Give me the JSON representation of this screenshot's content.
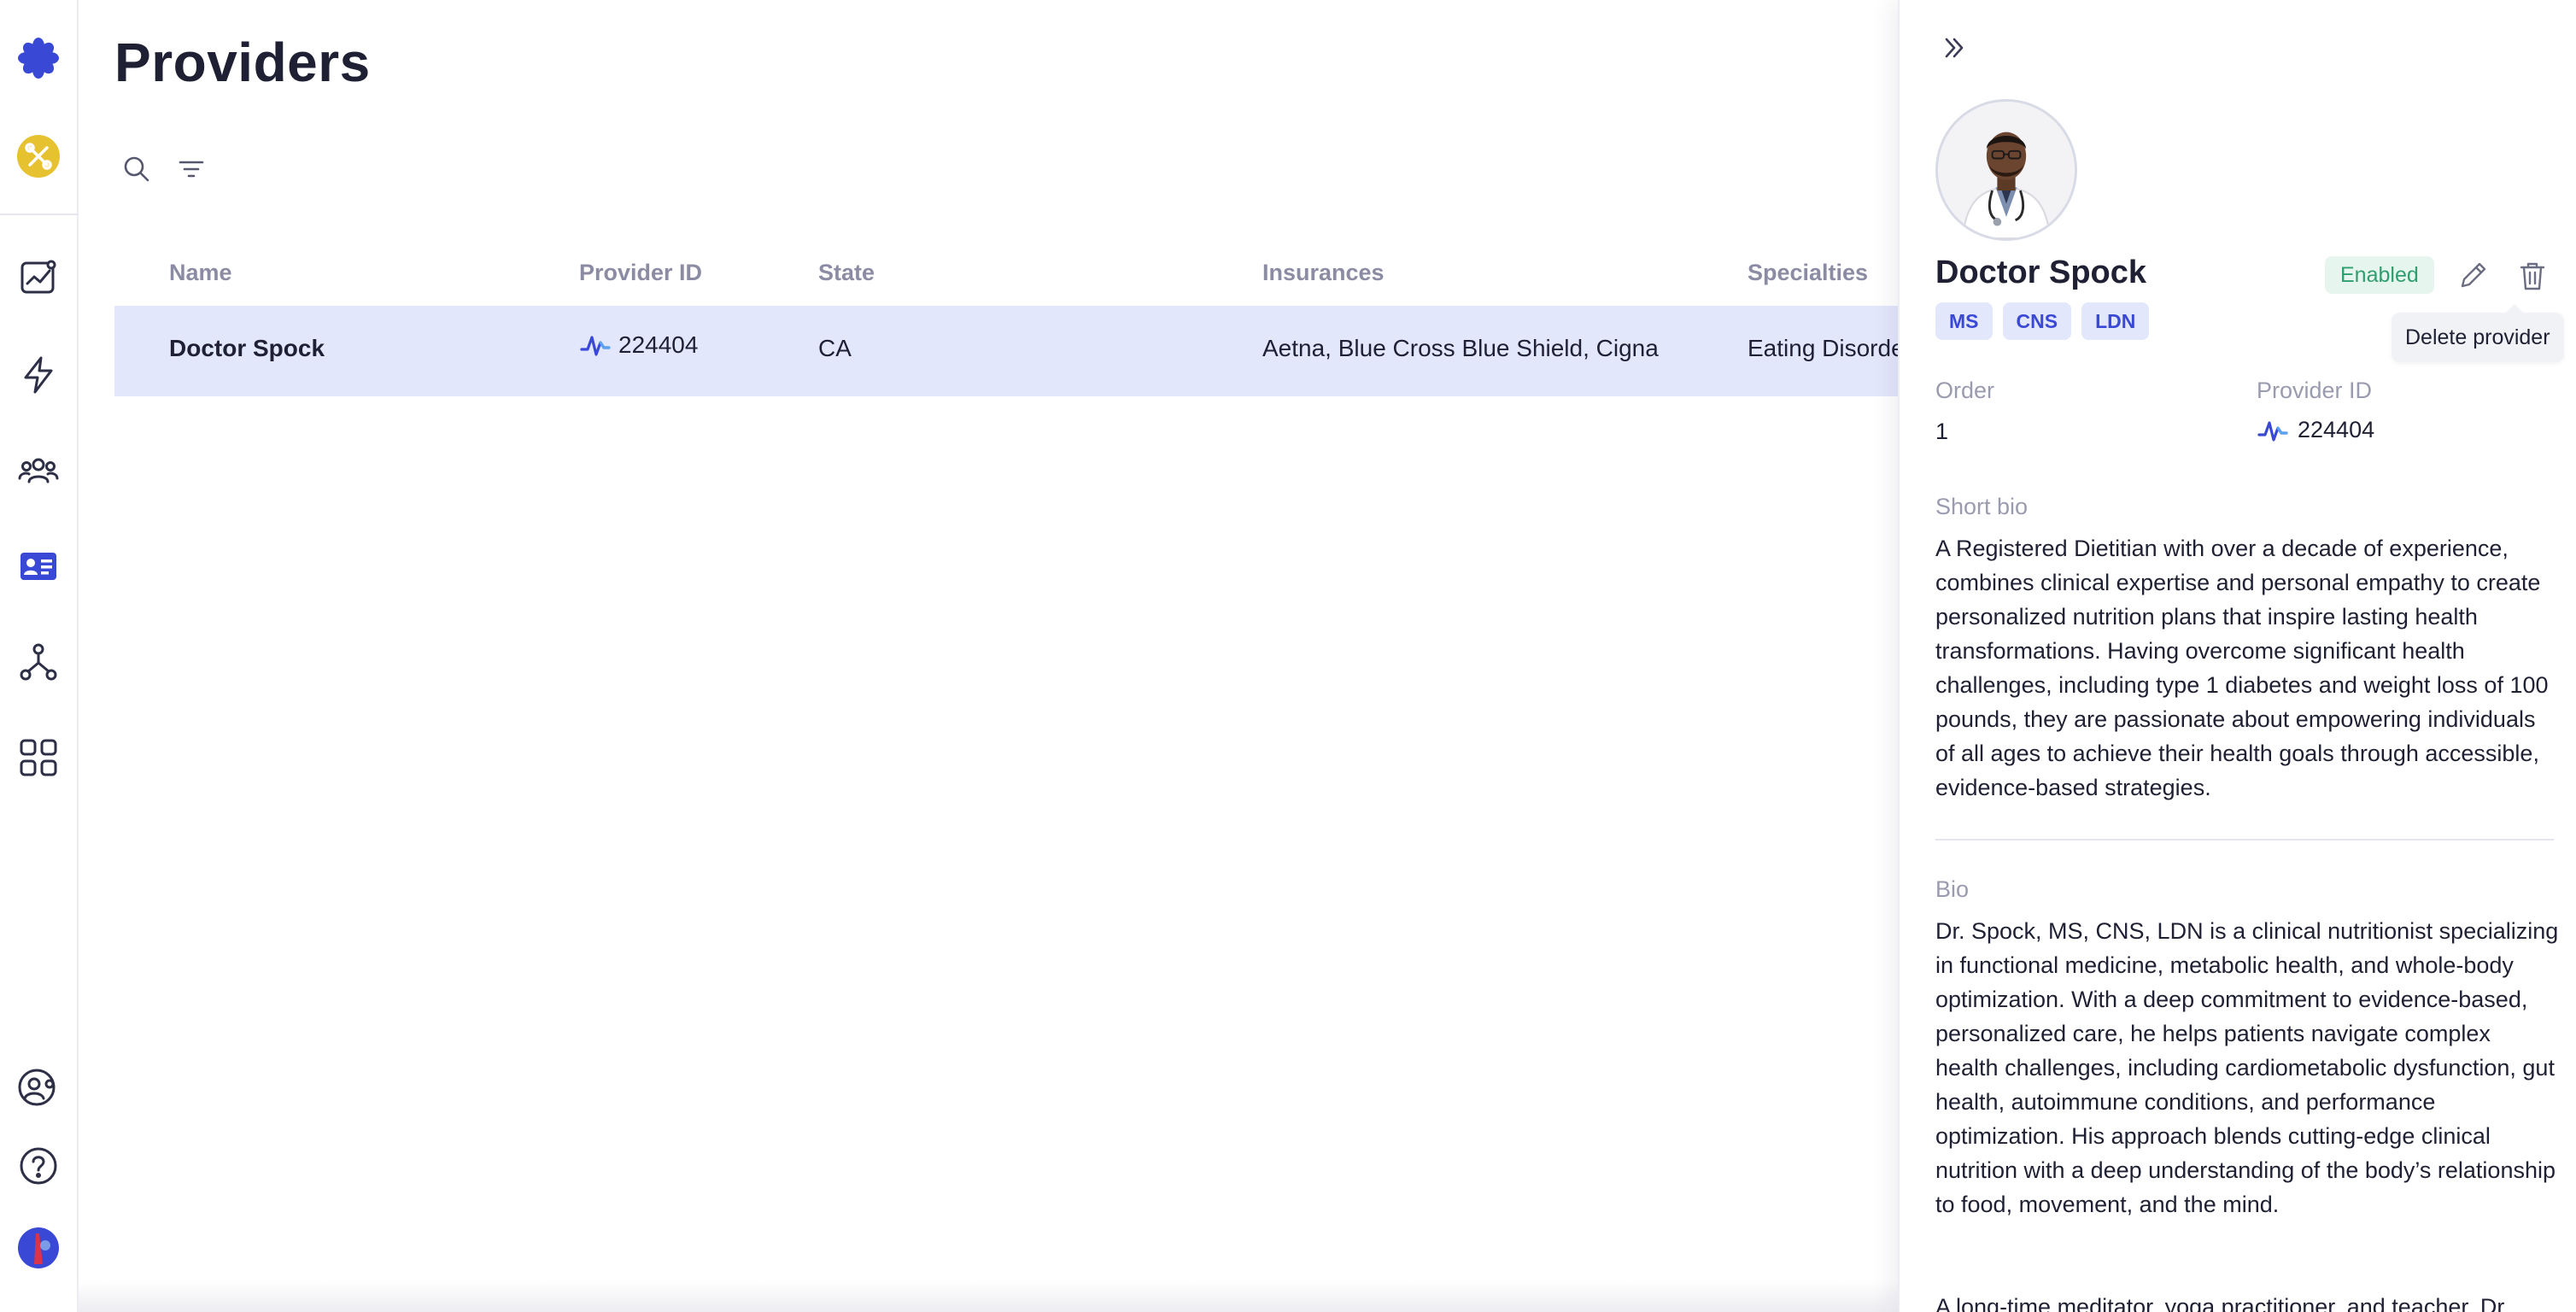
{
  "colors": {
    "accent": "#3a48d6",
    "selected_row": "#e3e7fb",
    "status_enabled": "#2f9e6f"
  },
  "nav": {
    "items": [
      {
        "name": "logo-icon"
      },
      {
        "name": "workspace-icon"
      },
      {
        "name": "analytics-icon"
      },
      {
        "name": "automations-icon"
      },
      {
        "name": "users-icon"
      },
      {
        "name": "providers-icon"
      },
      {
        "name": "integrations-icon"
      },
      {
        "name": "apps-icon"
      },
      {
        "name": "account-icon"
      },
      {
        "name": "help-icon"
      },
      {
        "name": "user-avatar"
      }
    ]
  },
  "page": {
    "title": "Providers"
  },
  "table": {
    "columns": [
      "Name",
      "Provider ID",
      "State",
      "Insurances",
      "Specialties"
    ],
    "rows": [
      {
        "name": "Doctor Spock",
        "provider_id": "224404",
        "state": "CA",
        "insurances": "Aetna, Blue Cross Blue Shield, Cigna",
        "specialties": "Eating Disorde"
      }
    ]
  },
  "panel": {
    "provider_name": "Doctor Spock",
    "status": "Enabled",
    "credentials": [
      "MS",
      "CNS",
      "LDN"
    ],
    "tooltip": "Delete provider",
    "order_label": "Order",
    "order_value": "1",
    "provider_id_label": "Provider ID",
    "provider_id_value": "224404",
    "short_bio_label": "Short bio",
    "short_bio": "A Registered Dietitian with over a decade of experience, combines clinical expertise and personal empathy to create personalized nutrition plans that inspire lasting health transformations. Having overcome significant health challenges, including type 1 diabetes and weight loss of 100 pounds, they are passionate about empowering individuals of all ages to achieve their health goals through accessible, evidence-based strategies.",
    "bio_label": "Bio",
    "bio_p1": "Dr. Spock, MS, CNS, LDN is a clinical nutritionist specializing in functional medicine, metabolic health, and whole-body optimization. With a deep commitment to evidence-based, personalized care, he helps patients navigate complex health challenges, including cardiometabolic dysfunction, gut health, autoimmune conditions, and performance optimization. His approach blends cutting-edge clinical nutrition with a deep understanding of the body’s relationship to food, movement, and the mind.",
    "bio_p2": "A long-time meditator, yoga practitioner, and teacher, Dr."
  }
}
